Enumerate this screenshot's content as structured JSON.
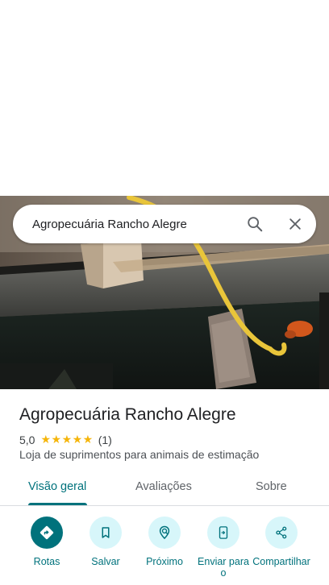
{
  "search": {
    "query": "Agropecuária Rancho Alegre"
  },
  "place": {
    "name": "Agropecuária Rancho Alegre",
    "rating": "5,0",
    "stars": "★★★★★",
    "review_count": "(1)",
    "category": "Loja de suprimentos para animais de estimação"
  },
  "tabs": [
    {
      "label": "Visão geral",
      "active": true
    },
    {
      "label": "Avaliações",
      "active": false
    },
    {
      "label": "Sobre",
      "active": false
    }
  ],
  "actions": [
    {
      "label": "Rotas",
      "icon": "directions-icon"
    },
    {
      "label": "Salvar",
      "icon": "bookmark-icon"
    },
    {
      "label": "Próximo",
      "icon": "nearby-icon"
    },
    {
      "label": "Enviar para o",
      "icon": "send-to-phone-icon"
    },
    {
      "label": "Compartilhar",
      "icon": "share-icon"
    }
  ],
  "colors": {
    "accent": "#00727c",
    "action_bg": "#d7f6fa",
    "star": "#f5b50a"
  }
}
